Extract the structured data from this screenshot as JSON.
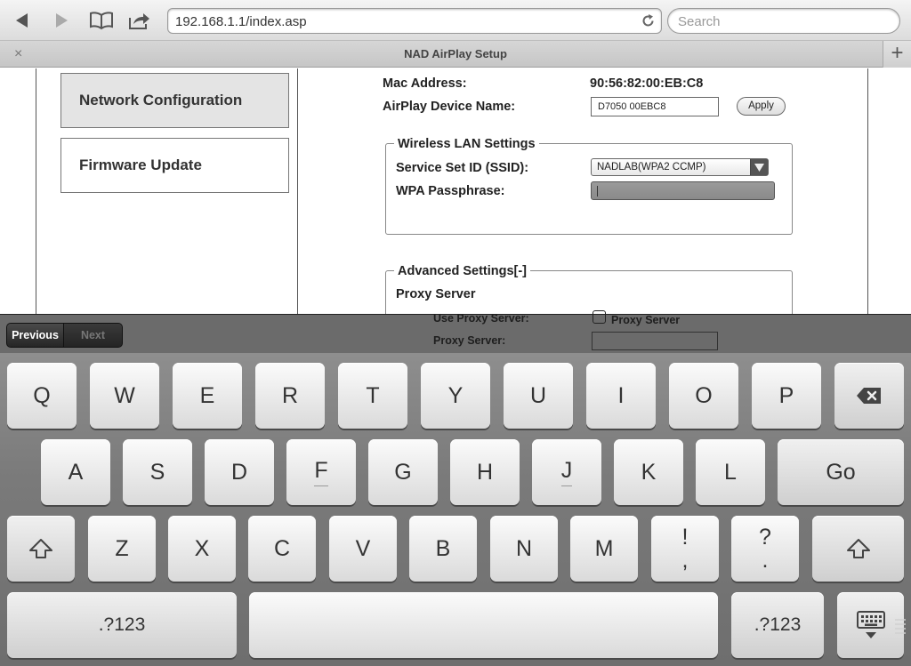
{
  "browser": {
    "url": "192.168.1.1/index.asp",
    "search_placeholder": "Search",
    "tab_title": "NAD AirPlay Setup",
    "tab_close": "×",
    "tab_new": "+"
  },
  "sidebar": {
    "items": [
      {
        "label": "Network Configuration",
        "active": true
      },
      {
        "label": "Firmware Update",
        "active": false
      }
    ]
  },
  "form": {
    "mac_label": "Mac Address:",
    "mac_value": "90:56:82:00:EB:C8",
    "device_name_label": "AirPlay Device Name:",
    "device_name_value": "D7050 00EBC8",
    "apply_label": "Apply",
    "wireless": {
      "legend": "Wireless LAN Settings",
      "ssid_label": "Service Set ID (SSID):",
      "ssid_value": "NADLAB(WPA2 CCMP)",
      "passphrase_label": "WPA Passphrase:"
    },
    "advanced": {
      "legend": "Advanced Settings[-]",
      "proxy_heading": "Proxy Server",
      "use_proxy_label": "Use Proxy Server:",
      "proxy_checkbox_label": "Proxy Server",
      "proxy_server_label": "Proxy Server:"
    }
  },
  "form_assistant": {
    "previous_label": "Previous",
    "next_label": "Next"
  },
  "keyboard": {
    "row1": [
      "Q",
      "W",
      "E",
      "R",
      "T",
      "Y",
      "U",
      "I",
      "O",
      "P"
    ],
    "row2": [
      "A",
      "S",
      "D",
      "F",
      "G",
      "H",
      "J",
      "K",
      "L"
    ],
    "row3": [
      "Z",
      "X",
      "C",
      "V",
      "B",
      "N",
      "M"
    ],
    "go_label": "Go",
    "numbers_label": ".?123",
    "punct1_top": "!",
    "punct1_bottom": ",",
    "punct2_top": "?",
    "punct2_bottom": "."
  },
  "icons": {
    "back": "back-arrow-icon",
    "forward": "forward-arrow-icon",
    "bookmarks": "open-book-icon",
    "share": "share-arrow-icon",
    "reload": "reload-icon",
    "backspace": "backspace-icon",
    "shift": "shift-arrow-icon",
    "hide_keyboard": "keyboard-dismiss-icon",
    "select_arrow": "triangle-down-icon"
  }
}
